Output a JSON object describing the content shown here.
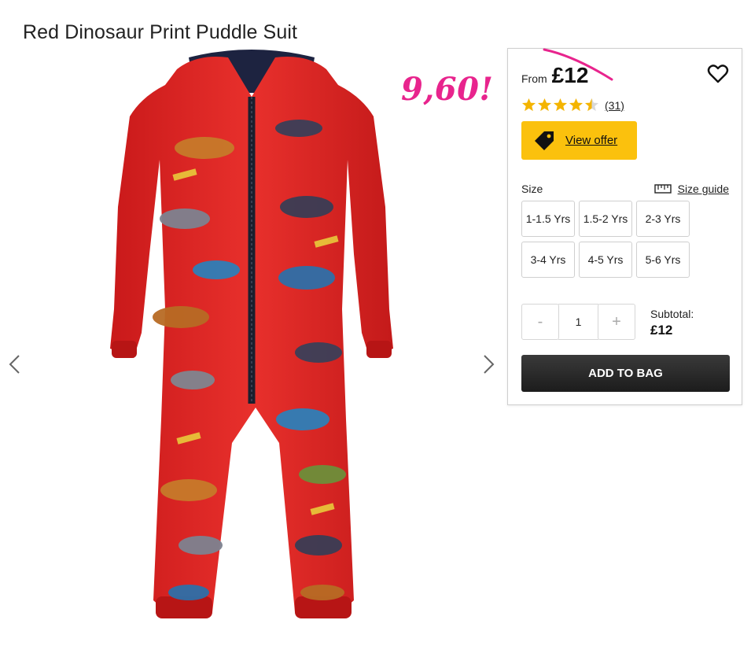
{
  "product": {
    "title": "Red Dinosaur Print Puddle Suit"
  },
  "annotation": {
    "handwritten_price": "9,60!",
    "color": "#e8248d"
  },
  "pricing": {
    "from_label": "From",
    "price": "£12"
  },
  "rating": {
    "stars": 4.5,
    "max": 5,
    "count": "(31)"
  },
  "offer": {
    "label": "View offer",
    "icon": "tag-icon",
    "color": "#fbc10d"
  },
  "sizes": {
    "label": "Size",
    "guide_label": "Size guide",
    "options": [
      "1-1.5 Yrs",
      "1.5-2 Yrs",
      "2-3 Yrs",
      "3-4 Yrs",
      "4-5 Yrs",
      "5-6 Yrs"
    ]
  },
  "quantity": {
    "minus": "-",
    "value": "1",
    "plus": "+"
  },
  "subtotal": {
    "label": "Subtotal:",
    "value": "£12"
  },
  "cart": {
    "add_label": "ADD TO BAG"
  },
  "image": {
    "subject": "red rain suit with dinosaur print"
  }
}
